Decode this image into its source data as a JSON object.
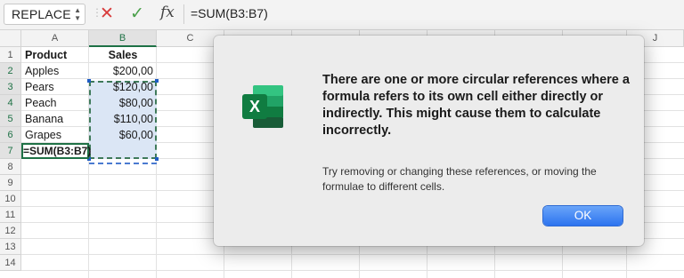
{
  "formula_bar": {
    "name_box": "REPLACE",
    "stepper_up": "▲",
    "stepper_down": "▼",
    "cancel_icon": "✕",
    "enter_icon": "✓",
    "fx_label": "fx",
    "formula": "=SUM(B3:B7)"
  },
  "columns": [
    "A",
    "B",
    "C",
    "J"
  ],
  "rows": [
    "1",
    "2",
    "3",
    "4",
    "5",
    "6",
    "7",
    "8",
    "9",
    "10",
    "11",
    "12",
    "13",
    "14"
  ],
  "cells": {
    "a1": "Product",
    "b1": "Sales",
    "a2": "Apples",
    "b2": "$200,00",
    "a3": "Pears",
    "b3": "$120,00",
    "a4": "Peach",
    "b4": "$80,00",
    "a5": "Banana",
    "b5": "$110,00",
    "a6": "Grapes",
    "b6": "$60,00",
    "a7": "=SUM(B3:B7)"
  },
  "dialog": {
    "title": "There are one or more circular references where a formula refers to its own cell either directly or indirectly. This might cause them to calculate incorrectly.",
    "body": "Try removing or changing these references, or moving the formulae to different cells.",
    "ok_label": "OK",
    "app_icon": "excel-icon",
    "icon_letter": "X"
  },
  "colors": {
    "excel_green": "#1e7145",
    "ok_blue": "#2c73ef",
    "cancel_red": "#d83b3b",
    "enter_green": "#4aa04a"
  }
}
